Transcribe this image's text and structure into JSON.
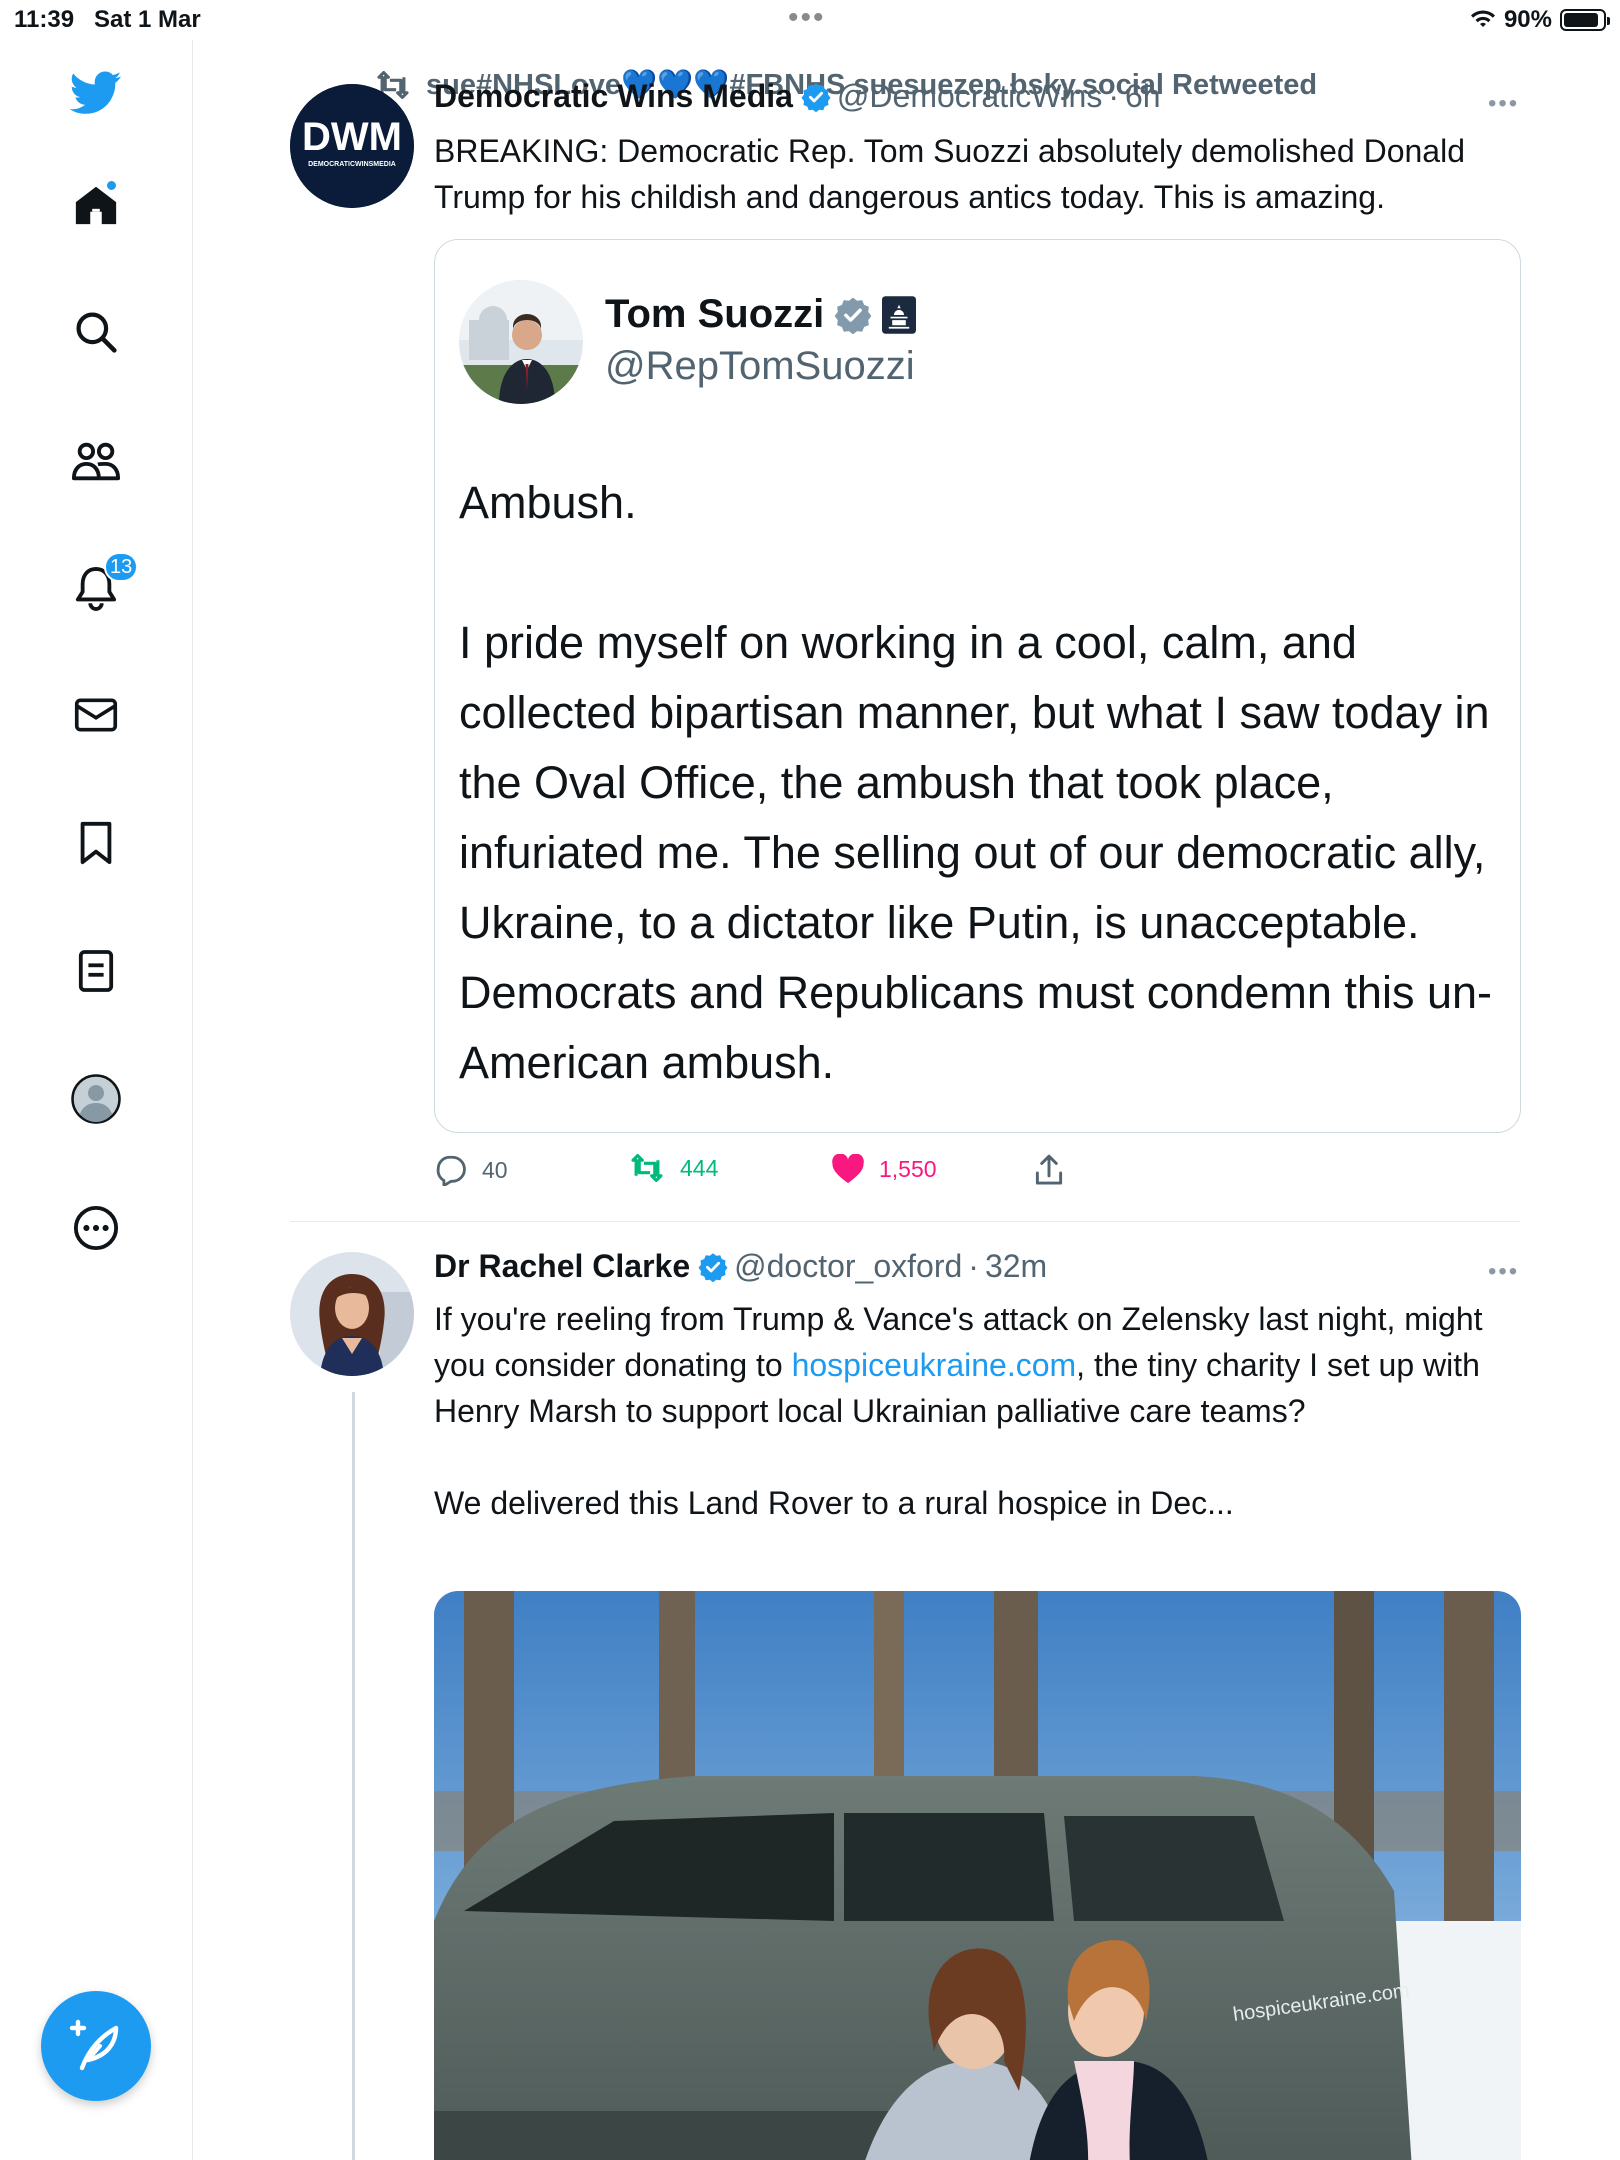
{
  "status_bar": {
    "time": "11:39",
    "date": "Sat 1 Mar",
    "battery": "90%",
    "battery_level": 0.9
  },
  "sidebar": {
    "notifications_badge": "13",
    "icons": [
      "twitter-bird-icon",
      "home-icon",
      "search-icon",
      "communities-icon",
      "bell-icon",
      "mail-icon",
      "bookmark-icon",
      "lists-icon",
      "profile-icon",
      "more-circle-icon"
    ],
    "compose_icon": "feather-plus-icon"
  },
  "retweet_context": {
    "text": "sue#NHSLove💙💙💙#FBNHS suesuezep.bsky.social Retweeted"
  },
  "tweet1": {
    "avatar_text": "DWM",
    "avatar_subtext": "DEMOCRATICWINSMEDIA",
    "name": "Democratic Wins Media",
    "handle": "@DemocraticWins",
    "separator": "·",
    "time": "6h",
    "text": "BREAKING: Democratic Rep. Tom Suozzi absolutely demolished Donald Trump for his childish and dangerous antics today. This is amazing.",
    "quote": {
      "name": "Tom Suozzi",
      "handle": "@RepTomSuozzi",
      "paragraph1": "Ambush.",
      "paragraph2": "I pride myself on working in a cool, calm, and collected bipartisan manner, but what I saw today in the Oval Office, the ambush that took place, infuriated me. The selling out of our democratic ally, Ukraine, to a dictator like Putin, is unacceptable. Democrats and Republicans must condemn this un-American ambush."
    },
    "replies": "40",
    "retweets": "444",
    "likes": "1,550",
    "retweeted_by_user": true,
    "liked_by_user": true,
    "colors": {
      "retweet": "#00ba7c",
      "like": "#f91880"
    }
  },
  "tweet2": {
    "name": "Dr Rachel Clarke",
    "handle": "@doctor_oxford",
    "separator": "·",
    "time": "32m",
    "text_before_link": "If you're reeling from Trump & Vance's attack on Zelensky last night, might you consider donating to ",
    "link": "hospiceukraine.com",
    "text_after_link": ", the tiny charity I set up with Henry Marsh to support local Ukrainian palliative care teams?",
    "paragraph2": "We delivered this Land Rover to a rural hospice in Dec...",
    "media_caption_on_car": "hospiceukraine.com",
    "colors": {
      "link": "#1d9bf0"
    }
  },
  "theme": {
    "accent": "#1d9bf0",
    "text": "#0f1419",
    "secondary_text": "#536471",
    "border": "#cfd9de"
  }
}
